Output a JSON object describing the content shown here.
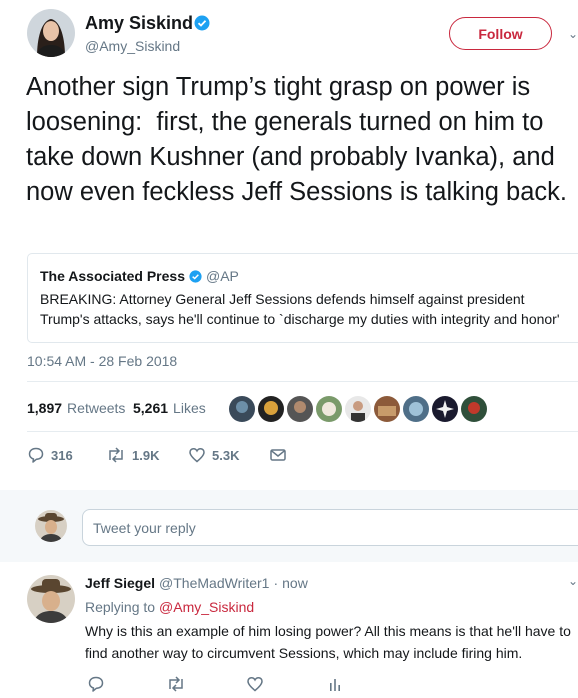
{
  "tweet": {
    "author_name": "Amy Siskind",
    "author_handle": "@Amy_Siskind",
    "follow_label": "Follow",
    "text": "Another sign Trump’s tight grasp on power is loosening:  first, the generals turned on him to take down Kushner (and probably Ivanka), and now even feckless Jeff Sessions is talking back.",
    "quoted": {
      "name": "The Associated Press",
      "handle": "@AP",
      "text": "BREAKING: Attorney General Jeff Sessions defends himself against president Trump's attacks, says he'll continue to `discharge my duties with integrity and honor'"
    },
    "timestamp": "10:54 AM - 28 Feb 2018",
    "stats": {
      "retweets_count": "1,897",
      "retweets_label": "Retweets",
      "likes_count": "5,261",
      "likes_label": "Likes"
    },
    "actions": {
      "replies": "316",
      "retweets": "1.9K",
      "likes": "5.3K"
    }
  },
  "reply_composer": {
    "placeholder": "Tweet your reply"
  },
  "reply": {
    "author_name": "Jeff Siegel",
    "author_handle": "@TheMadWriter1",
    "separator": "·",
    "time": "now",
    "replying_to_prefix": "Replying to",
    "replying_to_handle": "@Amy_Siskind",
    "text": "Why is this an example of him losing power? All this means is that he'll have to find another way to circumvent Sessions, which may include firing him."
  },
  "colors": {
    "accent": "#c9283e",
    "verified": "#1da1f2",
    "muted": "#657786",
    "border": "#e1e8ed"
  },
  "icons": [
    "verified-badge-icon",
    "chevron-down-icon",
    "reply-icon",
    "retweet-icon",
    "heart-icon",
    "mail-icon",
    "analytics-icon"
  ]
}
